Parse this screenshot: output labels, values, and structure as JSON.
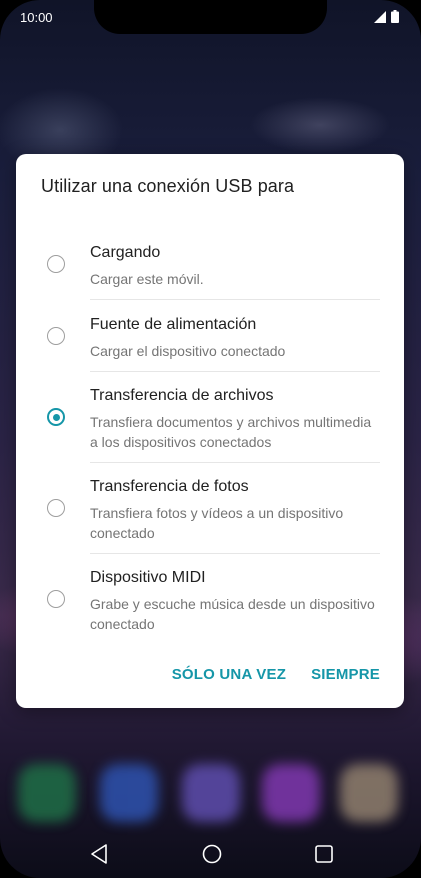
{
  "status_bar": {
    "time": "10:00",
    "icons": [
      "signal-icon",
      "battery-icon"
    ]
  },
  "dialog": {
    "title": "Utilizar una conexión USB para",
    "options": [
      {
        "title": "Cargando",
        "description": "Cargar este móvil.",
        "selected": false
      },
      {
        "title": "Fuente de alimentación",
        "description": "Cargar el dispositivo conectado",
        "selected": false
      },
      {
        "title": "Transferencia de archivos",
        "description": "Transfiera documentos y archivos multimedia a los dispositivos conectados",
        "selected": true
      },
      {
        "title": "Transferencia de fotos",
        "description": "Transfiera fotos y vídeos a un dispositivo conectado",
        "selected": false
      },
      {
        "title": "Dispositivo MIDI",
        "description": "Grabe y escuche música desde un dispositivo conectado",
        "selected": false
      }
    ],
    "buttons": {
      "once": "SÓLO UNA VEZ",
      "always": "SIEMPRE"
    }
  },
  "navigation": {
    "icons": [
      "back-icon",
      "home-icon",
      "recents-icon"
    ]
  },
  "colors": {
    "accent": "#1596a8",
    "dialog_background": "#ffffff",
    "title_text": "#212121",
    "secondary_text": "#757575"
  }
}
